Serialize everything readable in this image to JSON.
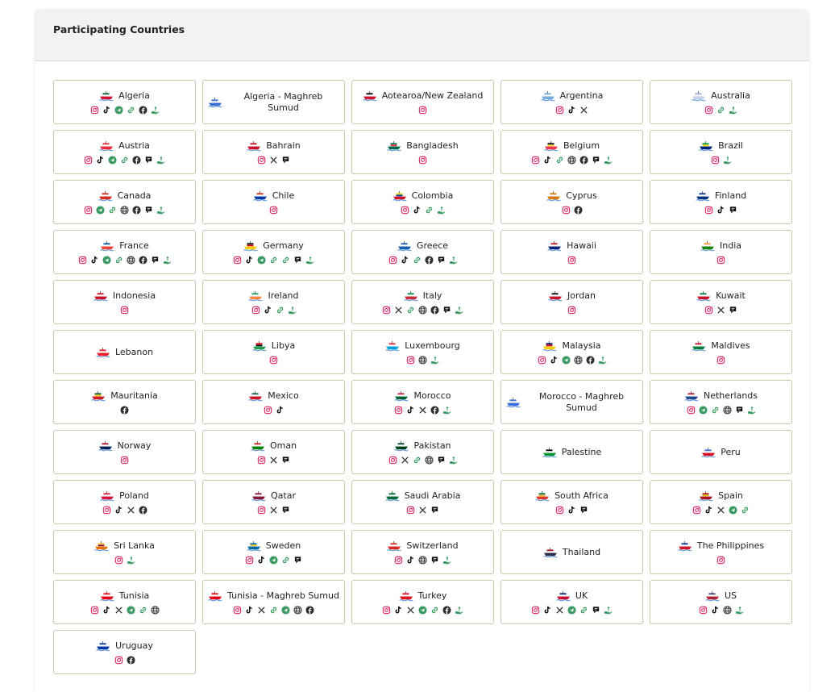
{
  "section": {
    "title": "Participating Countries"
  },
  "countries": [
    {
      "name": "Algeria",
      "colors": [
        "#006233",
        "#ffffff",
        "#d21034"
      ],
      "links": [
        "instagram",
        "tiktok",
        "telegram",
        "link",
        "facebook",
        "help"
      ]
    },
    {
      "name": "Algeria - Maghreb Sumud",
      "colors": [
        "#3b6fd6",
        "#ffffff",
        "#3b6fd6"
      ],
      "links": []
    },
    {
      "name": "Aotearoa/New Zealand",
      "colors": [
        "#000000",
        "#ffffff",
        "#cc142b"
      ],
      "links": [
        "instagram"
      ]
    },
    {
      "name": "Argentina",
      "colors": [
        "#74acdf",
        "#ffffff",
        "#74acdf"
      ],
      "links": [
        "instagram",
        "tiktok",
        "x"
      ]
    },
    {
      "name": "Australia",
      "colors": [
        "#9fb0d8",
        "#ffffff",
        "#c6d2ea"
      ],
      "links": [
        "instagram",
        "link",
        "help"
      ]
    },
    {
      "name": "Austria",
      "colors": [
        "#ed2939",
        "#ffffff",
        "#ed2939"
      ],
      "links": [
        "instagram",
        "tiktok",
        "telegram",
        "link",
        "facebook",
        "chat",
        "help"
      ]
    },
    {
      "name": "Bahrain",
      "colors": [
        "#ce1126",
        "#ffffff",
        "#ce1126"
      ],
      "links": [
        "instagram",
        "x",
        "chat"
      ]
    },
    {
      "name": "Bangladesh",
      "colors": [
        "#006a4e",
        "#f42a41",
        "#006a4e"
      ],
      "links": [
        "instagram"
      ]
    },
    {
      "name": "Belgium",
      "colors": [
        "#000000",
        "#fdda24",
        "#ef3340"
      ],
      "links": [
        "instagram",
        "tiktok",
        "link",
        "web",
        "facebook",
        "chat",
        "help"
      ]
    },
    {
      "name": "Brazil",
      "colors": [
        "#009c3b",
        "#ffdf00",
        "#002776"
      ],
      "links": [
        "instagram",
        "help"
      ]
    },
    {
      "name": "Canada",
      "colors": [
        "#d52b1e",
        "#ffffff",
        "#d52b1e"
      ],
      "links": [
        "instagram",
        "telegram",
        "link",
        "web",
        "facebook",
        "chat",
        "help"
      ]
    },
    {
      "name": "Chile",
      "colors": [
        "#d52b1e",
        "#ffffff",
        "#0039a6"
      ],
      "links": [
        "instagram"
      ]
    },
    {
      "name": "Colombia",
      "colors": [
        "#fcd116",
        "#003893",
        "#ce1126"
      ],
      "links": [
        "instagram",
        "tiktok",
        "link",
        "help"
      ]
    },
    {
      "name": "Cyprus",
      "colors": [
        "#d57800",
        "#ffffff",
        "#d57800"
      ],
      "links": [
        "instagram",
        "facebook"
      ]
    },
    {
      "name": "Finland",
      "colors": [
        "#003580",
        "#ffffff",
        "#003580"
      ],
      "links": [
        "instagram",
        "tiktok",
        "chat"
      ]
    },
    {
      "name": "France",
      "colors": [
        "#0055a4",
        "#ffffff",
        "#ef4135"
      ],
      "links": [
        "instagram",
        "tiktok",
        "telegram",
        "link",
        "web",
        "facebook",
        "chat",
        "help"
      ]
    },
    {
      "name": "Germany",
      "colors": [
        "#000000",
        "#dd0000",
        "#ffce00"
      ],
      "links": [
        "instagram",
        "tiktok",
        "telegram",
        "link",
        "link",
        "chat",
        "help"
      ]
    },
    {
      "name": "Greece",
      "colors": [
        "#0d5eaf",
        "#ffffff",
        "#0d5eaf"
      ],
      "links": [
        "instagram",
        "tiktok",
        "link",
        "facebook",
        "chat",
        "help"
      ]
    },
    {
      "name": "Hawaii",
      "colors": [
        "#ce1126",
        "#ffffff",
        "#00247d"
      ],
      "links": [
        "instagram"
      ]
    },
    {
      "name": "India",
      "colors": [
        "#ff9933",
        "#ffffff",
        "#138808"
      ],
      "links": [
        "instagram"
      ]
    },
    {
      "name": "Indonesia",
      "colors": [
        "#ce1126",
        "#ffffff",
        "#ce1126"
      ],
      "links": [
        "instagram"
      ]
    },
    {
      "name": "Ireland",
      "colors": [
        "#169b62",
        "#ffffff",
        "#ff883e"
      ],
      "links": [
        "instagram",
        "tiktok",
        "link",
        "help"
      ]
    },
    {
      "name": "Italy",
      "colors": [
        "#009246",
        "#ffffff",
        "#ce2b37"
      ],
      "links": [
        "instagram",
        "x",
        "link",
        "web",
        "facebook",
        "chat",
        "help"
      ]
    },
    {
      "name": "Jordan",
      "colors": [
        "#000000",
        "#ffffff",
        "#ce1126"
      ],
      "links": [
        "instagram"
      ]
    },
    {
      "name": "Kuwait",
      "colors": [
        "#007a3d",
        "#ffffff",
        "#ce1126"
      ],
      "links": [
        "instagram",
        "x",
        "chat"
      ]
    },
    {
      "name": "Lebanon",
      "colors": [
        "#ed1c24",
        "#ffffff",
        "#ed1c24"
      ],
      "links": []
    },
    {
      "name": "Libya",
      "colors": [
        "#e70013",
        "#000000",
        "#239e46"
      ],
      "links": [
        "instagram"
      ]
    },
    {
      "name": "Luxembourg",
      "colors": [
        "#ed2939",
        "#ffffff",
        "#00a1de"
      ],
      "links": [
        "instagram",
        "web",
        "help"
      ]
    },
    {
      "name": "Malaysia",
      "colors": [
        "#010066",
        "#cc0001",
        "#ffcc00"
      ],
      "links": [
        "instagram",
        "tiktok",
        "telegram",
        "web",
        "facebook",
        "help"
      ]
    },
    {
      "name": "Maldives",
      "colors": [
        "#d21034",
        "#ffffff",
        "#007e3a"
      ],
      "links": [
        "instagram"
      ]
    },
    {
      "name": "Mauritania",
      "colors": [
        "#006233",
        "#ffc400",
        "#d01c1f"
      ],
      "links": [
        "facebook"
      ]
    },
    {
      "name": "Mexico",
      "colors": [
        "#006847",
        "#ffffff",
        "#ce1126"
      ],
      "links": [
        "instagram",
        "tiktok"
      ]
    },
    {
      "name": "Morocco",
      "colors": [
        "#c1272d",
        "#ffffff",
        "#006233"
      ],
      "links": [
        "instagram",
        "tiktok",
        "x",
        "facebook",
        "help"
      ]
    },
    {
      "name": "Morocco - Maghreb Sumud",
      "colors": [
        "#3b6fd6",
        "#ffffff",
        "#3b6fd6"
      ],
      "links": []
    },
    {
      "name": "Netherlands",
      "colors": [
        "#ae1c28",
        "#ffffff",
        "#21468b"
      ],
      "links": [
        "instagram",
        "telegram",
        "link",
        "web",
        "chat",
        "help"
      ]
    },
    {
      "name": "Norway",
      "colors": [
        "#ba0c2f",
        "#ffffff",
        "#00205b"
      ],
      "links": [
        "instagram"
      ]
    },
    {
      "name": "Oman",
      "colors": [
        "#db161b",
        "#ffffff",
        "#008000"
      ],
      "links": [
        "instagram",
        "x",
        "chat"
      ]
    },
    {
      "name": "Pakistan",
      "colors": [
        "#01411c",
        "#ffffff",
        "#01411c"
      ],
      "links": [
        "instagram",
        "x",
        "link",
        "web",
        "chat",
        "help"
      ]
    },
    {
      "name": "Palestine",
      "colors": [
        "#000000",
        "#ffffff",
        "#009736"
      ],
      "links": []
    },
    {
      "name": "Peru",
      "colors": [
        "#3b6fd6",
        "#ffffff",
        "#d91023"
      ],
      "links": []
    },
    {
      "name": "Poland",
      "colors": [
        "#dc143c",
        "#ffffff",
        "#dc143c"
      ],
      "links": [
        "instagram",
        "tiktok",
        "x",
        "facebook"
      ]
    },
    {
      "name": "Qatar",
      "colors": [
        "#8a1538",
        "#ffffff",
        "#8a1538"
      ],
      "links": [
        "instagram",
        "x",
        "chat"
      ]
    },
    {
      "name": "Saudi Arabia",
      "colors": [
        "#006c35",
        "#ffffff",
        "#006c35"
      ],
      "links": [
        "instagram",
        "x",
        "chat"
      ]
    },
    {
      "name": "South Africa",
      "colors": [
        "#007749",
        "#ffb612",
        "#de3831"
      ],
      "links": [
        "instagram",
        "tiktok",
        "chat"
      ]
    },
    {
      "name": "Spain",
      "colors": [
        "#aa151b",
        "#f1bf00",
        "#aa151b"
      ],
      "links": [
        "instagram",
        "tiktok",
        "x",
        "telegram",
        "link"
      ]
    },
    {
      "name": "Sri Lanka",
      "colors": [
        "#ffbe29",
        "#8d153a",
        "#eb7400"
      ],
      "links": [
        "instagram",
        "help"
      ]
    },
    {
      "name": "Sweden",
      "colors": [
        "#006aa7",
        "#fecc00",
        "#006aa7"
      ],
      "links": [
        "instagram",
        "tiktok",
        "telegram",
        "link",
        "chat"
      ]
    },
    {
      "name": "Switzerland",
      "colors": [
        "#d52b1e",
        "#ffffff",
        "#d52b1e"
      ],
      "links": [
        "instagram",
        "tiktok",
        "web",
        "chat",
        "help"
      ]
    },
    {
      "name": "Thailand",
      "colors": [
        "#a51931",
        "#f4f5f8",
        "#2d2a4a"
      ],
      "links": []
    },
    {
      "name": "The Philippines",
      "colors": [
        "#0038a8",
        "#ffffff",
        "#ce1126"
      ],
      "links": [
        "instagram"
      ]
    },
    {
      "name": "Tunisia",
      "colors": [
        "#e70013",
        "#ffffff",
        "#e70013"
      ],
      "links": [
        "instagram",
        "tiktok",
        "x",
        "telegram",
        "link",
        "web"
      ]
    },
    {
      "name": "Tunisia - Maghreb Sumud",
      "colors": [
        "#e70013",
        "#ffffff",
        "#e70013"
      ],
      "links": [
        "instagram",
        "tiktok",
        "x",
        "link",
        "telegram",
        "web",
        "facebook"
      ]
    },
    {
      "name": "Turkey",
      "colors": [
        "#e30a17",
        "#ffffff",
        "#e30a17"
      ],
      "links": [
        "instagram",
        "tiktok",
        "x",
        "telegram",
        "link",
        "facebook",
        "help"
      ]
    },
    {
      "name": "UK",
      "colors": [
        "#012169",
        "#ffffff",
        "#c8102e"
      ],
      "links": [
        "instagram",
        "tiktok",
        "x",
        "telegram",
        "link",
        "chat",
        "help"
      ]
    },
    {
      "name": "US",
      "colors": [
        "#3c3b6e",
        "#ffffff",
        "#b22234"
      ],
      "links": [
        "instagram",
        "tiktok",
        "web",
        "help"
      ]
    },
    {
      "name": "Uruguay",
      "colors": [
        "#0038a8",
        "#ffffff",
        "#0038a8"
      ],
      "links": [
        "instagram",
        "facebook"
      ]
    }
  ]
}
